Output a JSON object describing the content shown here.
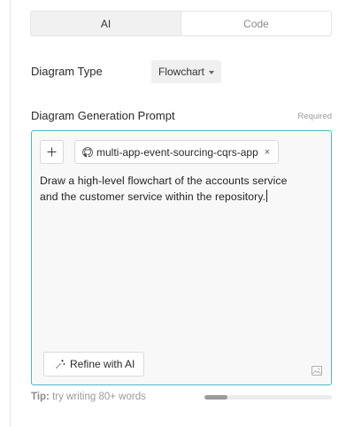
{
  "mode_toggle": {
    "options": [
      "AI",
      "Code"
    ],
    "selected": "AI"
  },
  "diagram_type": {
    "label": "Diagram Type",
    "selected": "Flowchart"
  },
  "prompt": {
    "label": "Diagram Generation Prompt",
    "required_text": "Required",
    "context_chip": {
      "label": "multi-app-event-sourcing-cqrs-app",
      "icon": "github-icon",
      "remove_label": "×"
    },
    "add_label": "+",
    "text_line1": "Draw a high-level flowchart of the accounts service",
    "text_line2": "and the customer service within the repository.",
    "refine_label": "Refine with AI",
    "refine_icon": "sparkle-wand-icon",
    "attach_icon": "image-icon"
  },
  "tip": {
    "prefix": "Tip:",
    "text": " try writing 80+ words",
    "progress_fraction": 0.18
  },
  "colors": {
    "focus_border": "#4fb6c7",
    "progress_fill": "#9b9b9b"
  }
}
